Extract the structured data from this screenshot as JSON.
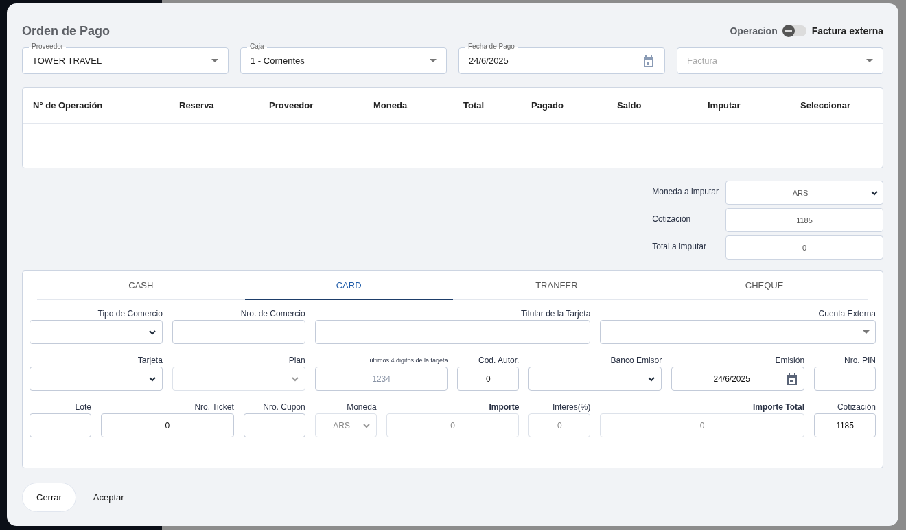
{
  "dialog": {
    "title": "Orden de Pago",
    "operation_toggle": {
      "left_label": "Operacion",
      "right_label": "Factura externa",
      "on": false
    },
    "header_fields": [
      {
        "kind": "dropdown",
        "label": "Proveedor",
        "value": "TOWER TRAVEL"
      },
      {
        "kind": "dropdown",
        "label": "Caja",
        "value": "1 - Corrientes"
      },
      {
        "kind": "date",
        "label": "Fecha de Pago",
        "value": "24/6/2025"
      },
      {
        "kind": "dropdown",
        "placeholder": "Factura"
      }
    ],
    "table": {
      "columns": [
        "N° de Operación",
        "Reserva",
        "Proveedor",
        "Moneda",
        "Total",
        "Pagado",
        "Saldo",
        "Imputar",
        "Seleccionar"
      ]
    },
    "imputation": [
      {
        "kind": "select",
        "label": "Moneda a imputar",
        "value": "ARS"
      },
      {
        "kind": "input",
        "label": "Cotización",
        "value": "1185"
      },
      {
        "kind": "input",
        "label": "Total a imputar",
        "value": "0"
      }
    ],
    "payment_tabs": [
      {
        "label": "CASH",
        "selected": false
      },
      {
        "label": "CARD",
        "selected": true
      },
      {
        "label": "TRANFER",
        "selected": false
      },
      {
        "label": "CHEQUE",
        "selected": false
      }
    ],
    "card_form": {
      "groups": [
        {
          "fields": [
            {
              "label": "Tipo de Comercio",
              "bold_label": false,
              "small_label": false,
              "kind": "select",
              "disabled": false
            },
            {
              "label": "Nro. de Comercio",
              "bold_label": false,
              "small_label": false,
              "kind": "input",
              "disabled": false
            },
            {
              "label": "Titular de la Tarjeta",
              "bold_label": false,
              "small_label": false,
              "kind": "input",
              "disabled": false
            },
            {
              "label": "Cuenta Externa",
              "bold_label": false,
              "small_label": false,
              "kind": "dropdown",
              "disabled": false
            }
          ]
        },
        {
          "fields": [
            {
              "label": "Tarjeta",
              "bold_label": false,
              "small_label": false,
              "kind": "select",
              "disabled": false
            },
            {
              "label": "Plan",
              "bold_label": false,
              "small_label": false,
              "kind": "select",
              "disabled": true
            },
            {
              "label": "últimos 4 digitos de la tarjeta",
              "bold_label": false,
              "small_label": true,
              "kind": "input",
              "placeholder": "1234",
              "disabled": false
            },
            {
              "label": "Cod. Autor.",
              "bold_label": false,
              "small_label": false,
              "kind": "input",
              "value": "0",
              "disabled": false
            },
            {
              "label": "Banco Emisor",
              "bold_label": false,
              "small_label": false,
              "kind": "select",
              "disabled": false
            },
            {
              "label": "Emisión",
              "bold_label": false,
              "small_label": false,
              "kind": "date",
              "value": "24/6/2025",
              "disabled": false
            },
            {
              "label": "Nro. PIN",
              "bold_label": false,
              "small_label": false,
              "kind": "input",
              "disabled": false
            }
          ]
        },
        {
          "fields": [
            {
              "label": "Lote",
              "bold_label": false,
              "small_label": false,
              "kind": "input",
              "disabled": false
            },
            {
              "label": "Nro. Ticket",
              "bold_label": false,
              "small_label": false,
              "kind": "input",
              "value": "0",
              "disabled": false
            },
            {
              "label": "Nro. Cupon",
              "bold_label": false,
              "small_label": false,
              "kind": "input",
              "disabled": false
            },
            {
              "label": "Moneda",
              "bold_label": false,
              "small_label": false,
              "kind": "select",
              "value": "ARS",
              "disabled": true
            },
            {
              "label": "Importe",
              "bold_label": true,
              "small_label": false,
              "kind": "input",
              "value": "0",
              "disabled": true
            },
            {
              "label": "Interes(%)",
              "bold_label": false,
              "small_label": false,
              "kind": "input",
              "value": "0",
              "disabled": true
            },
            {
              "label": "Importe Total",
              "bold_label": true,
              "small_label": false,
              "kind": "input",
              "value": "0",
              "disabled": true
            },
            {
              "label": "Cotización",
              "bold_label": false,
              "small_label": false,
              "kind": "input",
              "value": "1185",
              "disabled": false
            }
          ]
        }
      ]
    },
    "buttons": [
      {
        "kind": "outlined",
        "label": "Cerrar"
      },
      {
        "kind": "text",
        "label": "Aceptar"
      }
    ]
  }
}
